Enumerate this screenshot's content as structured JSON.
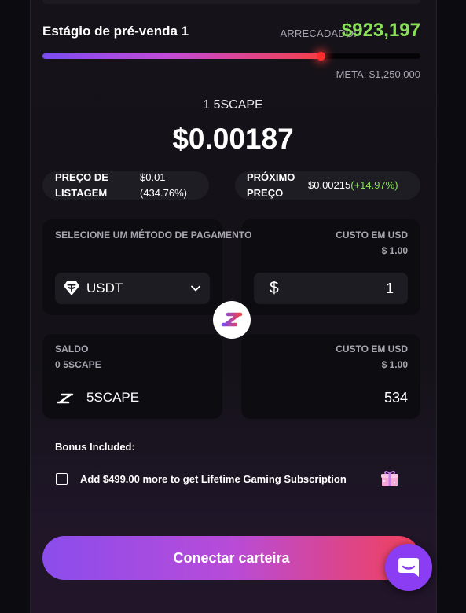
{
  "presale": {
    "stage_title": "Estágio de pré-venda 1",
    "raised_label": "ARRECADADO:",
    "raised_value": "$923,197",
    "goal_text": "META: $1,250,000",
    "progress": 0.7385
  },
  "token": {
    "name_line": "1 5SCAPE",
    "price": "$0.00187"
  },
  "listing_pill": {
    "label_line1": "PREÇO DE",
    "label_line2": "LISTAGEM",
    "value_line1": "$0.01",
    "value_line2": "(434.76%)"
  },
  "next_pill": {
    "label_line1": "PRÓXIMO",
    "label_line2": "PREÇO",
    "value": "$0.00215",
    "change": "(+14.97%)"
  },
  "payment": {
    "method_label": "SELECIONE UM MÉTODO DE PAGAMENTO",
    "selected_currency": "USDT",
    "cost_label": "CUSTO EM USD",
    "cost_value": "$ 1.00",
    "amount_symbol": "$",
    "amount_value": "1"
  },
  "balance": {
    "label": "SALDO",
    "value": "0 5SCAPE",
    "token_label": "5SCAPE",
    "cost_label": "CUSTO EM USD",
    "cost_value": "$ 1.00",
    "receive_value": "534"
  },
  "bonus": {
    "title": "Bonus Included:",
    "offer_text": "Add $499.00 more to get Lifetime Gaming Subscription"
  },
  "connect_button": "Conectar carteira",
  "colors": {
    "accent_green": "#8be05a",
    "accent_purple": "#8a3df3",
    "accent_red": "#f34159"
  }
}
